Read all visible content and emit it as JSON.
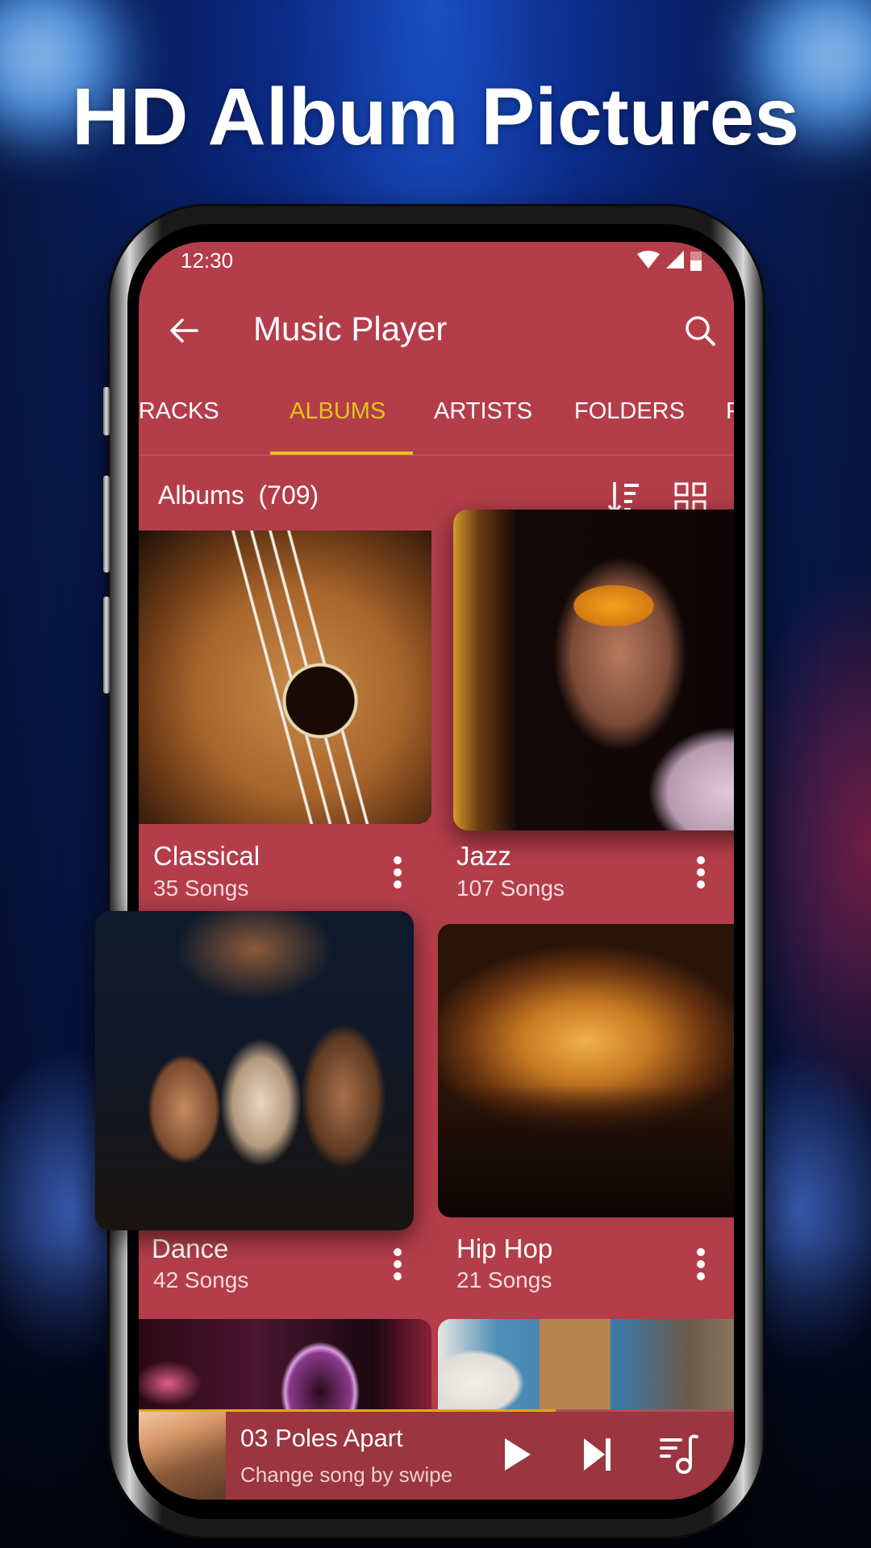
{
  "promo": {
    "headline": "HD Album Pictures"
  },
  "status_bar": {
    "time": "12:30",
    "icons": [
      "wifi-icon",
      "signal-icon",
      "battery-icon"
    ]
  },
  "app_bar": {
    "title": "Music Player",
    "back_icon": "arrow-left-icon",
    "search_icon": "search-icon"
  },
  "tabs": [
    {
      "label": "TRACKS",
      "active": false
    },
    {
      "label": "ALBUMS",
      "active": true
    },
    {
      "label": "ARTISTS",
      "active": false
    },
    {
      "label": "FOLDERS",
      "active": false
    },
    {
      "label": "P",
      "active": false
    }
  ],
  "list_header": {
    "title": "Albums",
    "count": "(709)",
    "sort_icon": "sort-descending-icon",
    "view_icon": "grid-view-icon"
  },
  "albums": [
    {
      "title": "Classical",
      "subtitle": "35 Songs",
      "art": "guitar-photo"
    },
    {
      "title": "Jazz",
      "subtitle": "107 Songs",
      "art": "woman-sunglasses-photo"
    },
    {
      "title": "Dance",
      "subtitle": "42 Songs",
      "art": "dancers-photo"
    },
    {
      "title": "Hip Hop",
      "subtitle": "21 Songs",
      "art": "concert-crowd-photo"
    },
    {
      "title": "",
      "subtitle": "",
      "art": "saxophone-photo"
    },
    {
      "title": "",
      "subtitle": "",
      "art": "electric-guitar-photo"
    }
  ],
  "mini_player": {
    "title": "03 Poles Apart",
    "subtitle": "Change song by swipe",
    "progress": 0.7,
    "colors": {
      "progress": "#e4a91a",
      "background": "#9b3540"
    }
  },
  "theme": {
    "primary": "#b43d4a",
    "accent": "#e4c41a",
    "text": "#ffffff"
  }
}
